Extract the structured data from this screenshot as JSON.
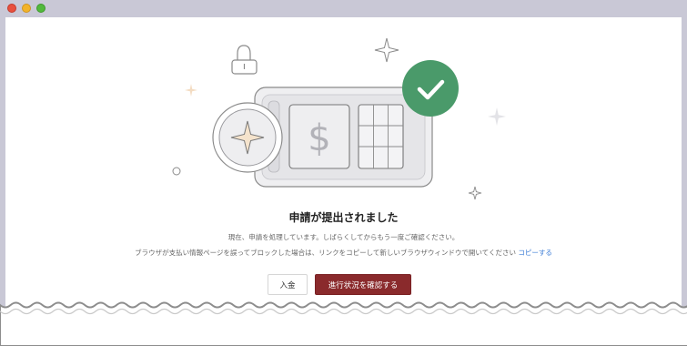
{
  "window": {
    "controls": [
      "close",
      "minimize",
      "zoom"
    ]
  },
  "illustration": {
    "icons": [
      "lock-icon",
      "dollar-icon",
      "card-grid-icon",
      "sparkle-icon",
      "check-icon"
    ],
    "dollar_glyph": "$",
    "colors": {
      "check_badge": "#4a9a6a",
      "sparkle_fill": "#f5e3cc",
      "outline": "#8a8a8a"
    }
  },
  "message": {
    "title": "申請が提出されました",
    "line1": "現在、申請を処理しています。しばらくしてからもう一度ご確認ください。",
    "line2": "ブラウザが支払い情報ページを誤ってブロックした場合は、リンクをコピーして新しいブラウザウィンドウで開いてください",
    "copy_link": "コピーする"
  },
  "actions": {
    "deposit_label": "入金",
    "progress_label": "進行状況を確認する"
  },
  "colors": {
    "primary_button": "#8a2a2c",
    "link": "#3a7bd5",
    "window_chrome": "#c9c8d6"
  }
}
